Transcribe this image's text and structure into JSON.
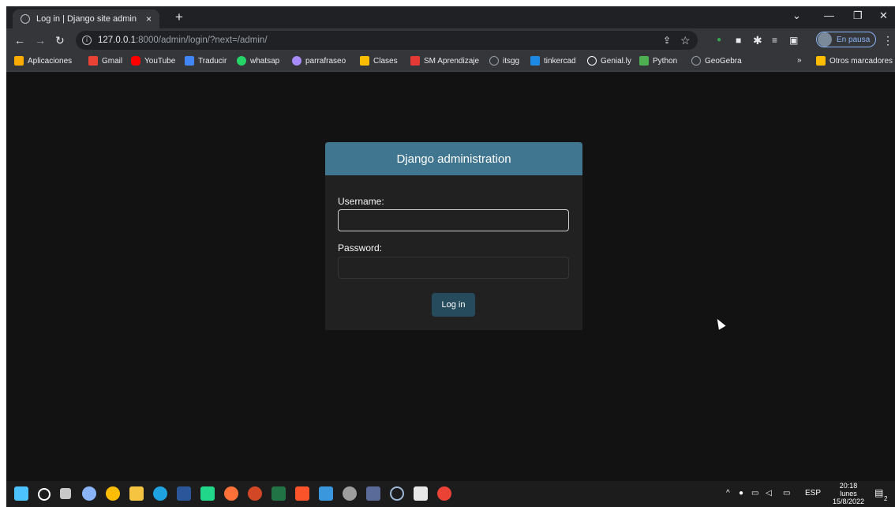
{
  "browser": {
    "tab_title": "Log in | Django site admin",
    "tab_close": "×",
    "new_tab": "+",
    "url_host": "127.0.0.1",
    "url_path": ":8000/admin/login/?next=/admin/",
    "profile_label": "En pausa"
  },
  "bookmarks": [
    {
      "label": "Aplicaciones",
      "icon": "apps-grid-icon",
      "color": "#f9ab00"
    },
    {
      "label": "Gmail",
      "icon": "gmail-icon",
      "color": "#ea4335"
    },
    {
      "label": "YouTube",
      "icon": "youtube-icon",
      "color": "#ff0000"
    },
    {
      "label": "Traducir",
      "icon": "translate-icon",
      "color": "#4285f4"
    },
    {
      "label": "whatsap",
      "icon": "whatsapp-icon",
      "color": "#25d366"
    },
    {
      "label": "parrafraseo",
      "icon": "globe-icon",
      "color": "#a78bfa"
    },
    {
      "label": "Clases",
      "icon": "classroom-icon",
      "color": "#fbbc04"
    },
    {
      "label": "SM Aprendizaje",
      "icon": "sm-icon",
      "color": "#e53935"
    },
    {
      "label": "itsgg",
      "icon": "globe-icon",
      "color": "#9aa0a6"
    },
    {
      "label": "tinkercad",
      "icon": "tinkercad-icon",
      "color": "#1e88e5"
    },
    {
      "label": "Genial.ly",
      "icon": "genially-icon",
      "color": "#ffffff"
    },
    {
      "label": "Python",
      "icon": "python-icon",
      "color": "#4caf50"
    },
    {
      "label": "GeoGebra",
      "icon": "geogebra-icon",
      "color": "#9aa0a6"
    }
  ],
  "bookmarks_more": "»",
  "other_bookmarks": "Otros marcadores",
  "login": {
    "header": "Django administration",
    "username_label": "Username:",
    "password_label": "Password:",
    "button": "Log in"
  },
  "taskbar": {
    "language": "ESP",
    "time": "20:18",
    "day": "lunes",
    "date": "15/8/2022",
    "notification_count": "2"
  }
}
